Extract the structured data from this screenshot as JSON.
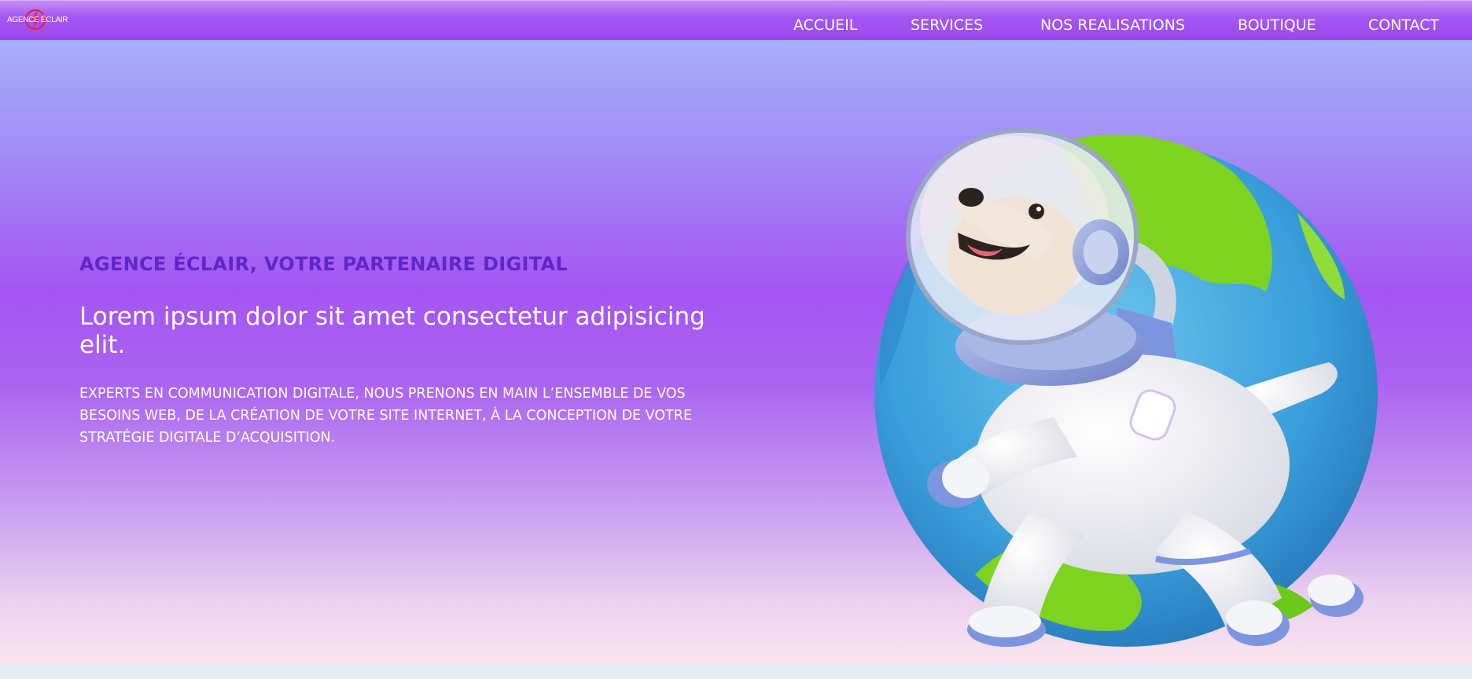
{
  "brand": {
    "logo_text": "AGENCE ÉCLAIR",
    "logo_icon": "lightning-bolt-icon",
    "accent_color": "#e8222c"
  },
  "nav": {
    "items": [
      {
        "label": "ACCUEIL"
      },
      {
        "label": "SERVICES"
      },
      {
        "label": "NOS REALISATIONS"
      },
      {
        "label": "BOUTIQUE"
      },
      {
        "label": "CONTACT"
      }
    ]
  },
  "hero": {
    "tagline": "AGENCE ÉCLAIR, VOTRE PARTENAIRE DIGITAL",
    "headline": "Lorem ipsum dolor sit amet consectetur adipisicing elit.",
    "description": "EXPERTS EN COMMUNICATION DIGITALE, NOUS PRENONS EN MAIN L’ENSEMBLE DE VOS BESOINS WEB, DE LA CRÉATION DE VOTRE SITE INTERNET, À LA CONCEPTION DE VOTRE STRATÉGIE DIGITALE D’ACQUISITION.",
    "illustration": "astronaut-dog-globe",
    "tagline_color": "#5e27c9"
  }
}
